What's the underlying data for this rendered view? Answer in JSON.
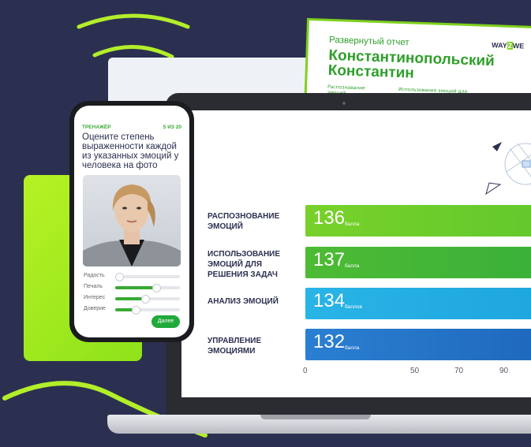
{
  "colors": {
    "background": "#2c3050",
    "accent_green": "#39a935",
    "lime": "#9be81f",
    "bar_green_1": "#6ccf2b",
    "bar_green_2": "#3bb23a",
    "bar_blue_1": "#1eaee0",
    "bar_blue_2": "#1a73c9"
  },
  "report": {
    "subtitle": "Развернутый отчет",
    "name": "Константинопольский Константин",
    "logo_a": "WAY",
    "logo_b": "2",
    "logo_c": "WE",
    "col1": "Распознавание эмоций",
    "col2": "Использование эмоций для решения задач"
  },
  "phone": {
    "section": "ТРЕНАЖЁР",
    "counter": "5 ИЗ 20",
    "question": "Оцените степень выраженности каждой из указанных эмоций у человека на фото",
    "sliders": [
      {
        "label": "Радость",
        "value": 0.05
      },
      {
        "label": "Печаль",
        "value": 0.62
      },
      {
        "label": "Интерес",
        "value": 0.45
      },
      {
        "label": "Доверие",
        "value": 0.3
      }
    ],
    "next_label": "Далее"
  },
  "chart_data": {
    "type": "bar",
    "orientation": "horizontal",
    "categories": [
      "РАСПОЗНОВАНИЕ ЭМОЦИЙ",
      "ИСПОЛЬЗОВАНИЕ ЭМОЦИЙ ДЛЯ РЕШЕНИЯ ЗАДАЧ",
      "АНАЛИЗ ЭМОЦИЙ",
      "УПРАВЛЕНИЕ ЭМОЦИЯМИ"
    ],
    "values": [
      136,
      137,
      134,
      132
    ],
    "units": [
      "балла",
      "балла",
      "баллов",
      "балла"
    ],
    "x_ticks": [
      "0",
      "50",
      "70",
      "90"
    ],
    "xlim": [
      0,
      130
    ]
  }
}
